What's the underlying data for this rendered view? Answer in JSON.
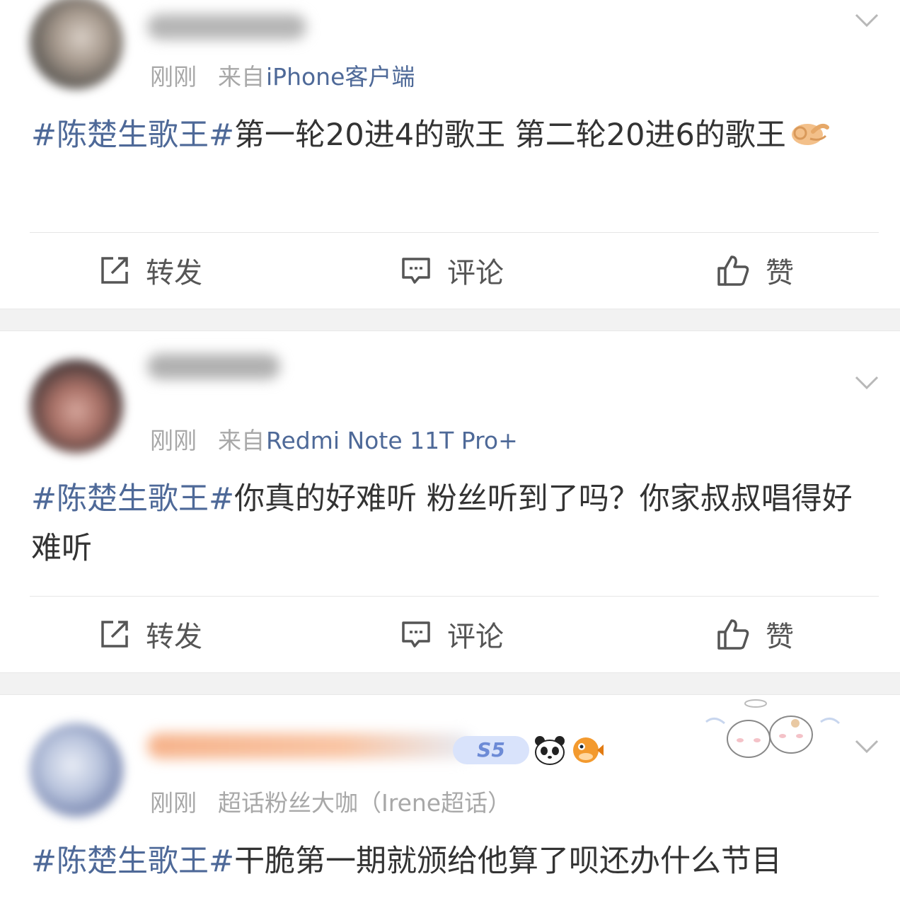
{
  "posts": [
    {
      "time": "刚刚",
      "source_prefix": "来自",
      "source_device": "iPhone客户端",
      "hashtag": "#陈楚生歌王#",
      "text": "第一轮20进4的歌王 第二轮20进6的歌王",
      "emoji": "ok-hand-emoji"
    },
    {
      "time": "刚刚",
      "source_prefix": "来自",
      "source_device": "Redmi Note 11T Pro+",
      "hashtag": "#陈楚生歌王#",
      "text": "你真的好难听 粉丝听到了吗？你家叔叔唱得好难听"
    },
    {
      "time": "刚刚",
      "source_prefix": "超话粉丝大咖（Irene超话）",
      "hashtag": "#陈楚生歌王#",
      "text": "干脆第一期就颁给他算了呗还办什么节目",
      "badge": "S5",
      "icons": [
        "panda-icon",
        "pufferfish-icon"
      ]
    }
  ],
  "actions": {
    "repost": "转发",
    "comment": "评论",
    "like": "赞"
  },
  "colors": {
    "link": "#4e6998",
    "text": "#333333",
    "meta": "#a8a8a8",
    "separator": "#f2f2f2"
  }
}
